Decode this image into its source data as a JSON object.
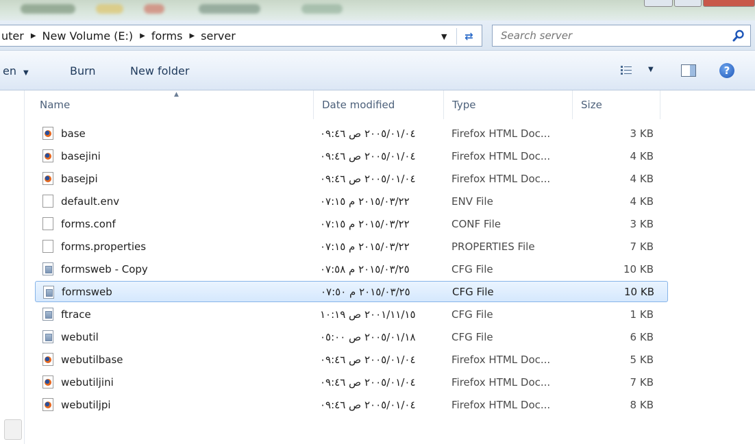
{
  "address_bar": {
    "breadcrumbs": [
      "uter",
      "New Volume (E:)",
      "forms",
      "server"
    ]
  },
  "search": {
    "placeholder": "Search server"
  },
  "toolbar": {
    "open_label": "en",
    "burn_label": "Burn",
    "new_folder_label": "New folder"
  },
  "columns": {
    "name": "Name",
    "date_modified": "Date modified",
    "type": "Type",
    "size": "Size"
  },
  "files": [
    {
      "name": "base",
      "date": "٢٠٠٥/٠١/٠٤ ص ٠٩:٤٦",
      "type": "Firefox HTML Doc...",
      "size": "3 KB",
      "icon": "firefox-html-icon"
    },
    {
      "name": "basejini",
      "date": "٢٠٠٥/٠١/٠٤ ص ٠٩:٤٦",
      "type": "Firefox HTML Doc...",
      "size": "4 KB",
      "icon": "firefox-html-icon"
    },
    {
      "name": "basejpi",
      "date": "٢٠٠٥/٠١/٠٤ ص ٠٩:٤٦",
      "type": "Firefox HTML Doc...",
      "size": "4 KB",
      "icon": "firefox-html-icon"
    },
    {
      "name": "default.env",
      "date": "٢٠١٥/٠٣/٢٢ م ٠٧:١٥",
      "type": "ENV File",
      "size": "4 KB",
      "icon": "blank-file-icon"
    },
    {
      "name": "forms.conf",
      "date": "٢٠١٥/٠٣/٢٢ م ٠٧:١٥",
      "type": "CONF File",
      "size": "3 KB",
      "icon": "blank-file-icon"
    },
    {
      "name": "forms.properties",
      "date": "٢٠١٥/٠٣/٢٢ م ٠٧:١٥",
      "type": "PROPERTIES File",
      "size": "7 KB",
      "icon": "blank-file-icon"
    },
    {
      "name": "formsweb - Copy",
      "date": "٢٠١٥/٠٣/٢٥ م ٠٧:٥٨",
      "type": "CFG File",
      "size": "10 KB",
      "icon": "cfg-file-icon"
    },
    {
      "name": "formsweb",
      "date": "٢٠١٥/٠٣/٢٥ م ٠٧:٥٠",
      "type": "CFG File",
      "size": "10 KB",
      "icon": "cfg-file-icon",
      "selected": true
    },
    {
      "name": "ftrace",
      "date": "٢٠٠١/١١/١٥ ص ١٠:١٩",
      "type": "CFG File",
      "size": "1 KB",
      "icon": "cfg-file-icon"
    },
    {
      "name": "webutil",
      "date": "٢٠٠٥/٠١/١٨ ص ٠٥:٠٠",
      "type": "CFG File",
      "size": "6 KB",
      "icon": "cfg-file-icon"
    },
    {
      "name": "webutilbase",
      "date": "٢٠٠٥/٠١/٠٤ ص ٠٩:٤٦",
      "type": "Firefox HTML Doc...",
      "size": "5 KB",
      "icon": "firefox-html-icon"
    },
    {
      "name": "webutiljini",
      "date": "٢٠٠٥/٠١/٠٤ ص ٠٩:٤٦",
      "type": "Firefox HTML Doc...",
      "size": "7 KB",
      "icon": "firefox-html-icon"
    },
    {
      "name": "webutiljpi",
      "date": "٢٠٠٥/٠١/٠٤ ص ٠٩:٤٦",
      "type": "Firefox HTML Doc...",
      "size": "8 KB",
      "icon": "firefox-html-icon"
    }
  ]
}
